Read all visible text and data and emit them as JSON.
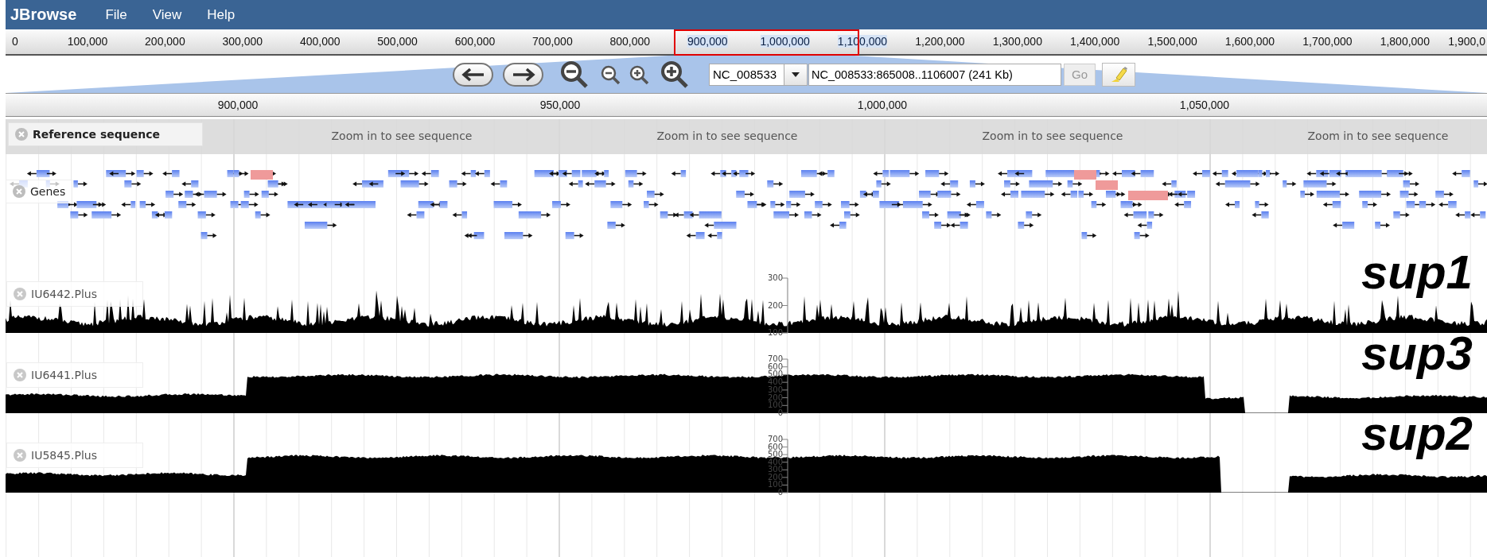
{
  "menu_bar": {
    "app_name": "JBrowse",
    "menus": [
      "File",
      "View",
      "Help"
    ]
  },
  "overview": {
    "ticks": [
      {
        "label": "0",
        "selected": false
      },
      {
        "label": "100,000",
        "selected": false
      },
      {
        "label": "200,000",
        "selected": false
      },
      {
        "label": "300,000",
        "selected": false
      },
      {
        "label": "400,000",
        "selected": false
      },
      {
        "label": "500,000",
        "selected": false
      },
      {
        "label": "600,000",
        "selected": false
      },
      {
        "label": "700,000",
        "selected": false
      },
      {
        "label": "800,000",
        "selected": false
      },
      {
        "label": "900,000",
        "selected": true
      },
      {
        "label": "1,000,000",
        "selected": true
      },
      {
        "label": "1,100,000",
        "selected": true
      },
      {
        "label": "1,200,000",
        "selected": false
      },
      {
        "label": "1,300,000",
        "selected": false
      },
      {
        "label": "1,400,000",
        "selected": false
      },
      {
        "label": "1,500,000",
        "selected": false
      },
      {
        "label": "1,600,000",
        "selected": false
      },
      {
        "label": "1,700,000",
        "selected": false
      },
      {
        "label": "1,800,000",
        "selected": false
      },
      {
        "label": "1,900,0",
        "selected": false
      }
    ]
  },
  "navigation": {
    "reference_select": {
      "value": "NC_008533"
    },
    "location_field": {
      "value": "NC_008533:865008..1106007 (241 Kb)"
    },
    "go_button": {
      "label": "Go",
      "disabled": true
    }
  },
  "detail_ruler": {
    "ticks": [
      "900,000",
      "950,000",
      "1,000,000",
      "1,050,000"
    ]
  },
  "tracks": [
    {
      "kind": "sequence",
      "label": "Reference sequence",
      "messages": [
        "Zoom in to see sequence",
        "Zoom in to see sequence",
        "Zoom in to see sequence",
        "Zoom in to see sequence"
      ]
    },
    {
      "kind": "features",
      "label": "Genes"
    },
    {
      "kind": "wiggle",
      "label": "IU6442.Plus",
      "y_ticks": [
        "300",
        "200",
        "100"
      ],
      "annotation": "sup1"
    },
    {
      "kind": "wiggle",
      "label": "IU6441.Plus",
      "y_ticks": [
        "700",
        "600",
        "500",
        "400",
        "300",
        "200",
        "100",
        "0"
      ],
      "annotation": "sup3"
    },
    {
      "kind": "wiggle",
      "label": "IU5845.Plus",
      "y_ticks": [
        "700",
        "600",
        "500",
        "400",
        "300",
        "200",
        "100",
        "0"
      ],
      "annotation": "sup2"
    }
  ]
}
